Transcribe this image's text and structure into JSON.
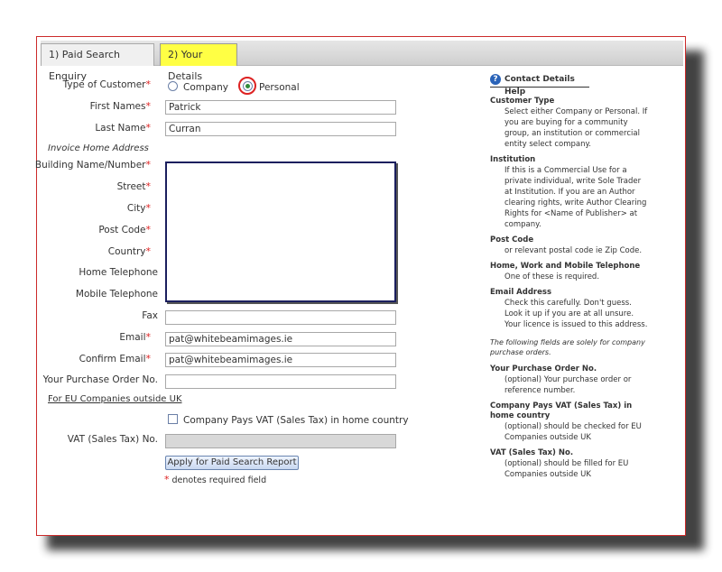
{
  "tabs": [
    {
      "label": "1) Paid Search Enquiry"
    },
    {
      "label": "2) Your Details"
    }
  ],
  "form": {
    "customer_type_label": "Type of Customer",
    "customer_type_options": [
      "Company",
      "Personal"
    ],
    "customer_type_selected": "Personal",
    "first_names_label": "First Names",
    "first_names_value": "Patrick",
    "last_name_label": "Last Name",
    "last_name_value": "Curran",
    "invoice_section": "Invoice Home Address",
    "building_label": "Building Name/Number",
    "street_label": "Street",
    "city_label": "City",
    "postcode_label": "Post Code",
    "country_label": "Country",
    "home_tel_label": "Home Telephone",
    "mobile_tel_label": "Mobile Telephone",
    "fax_label": "Fax",
    "fax_value": "",
    "email_label": "Email",
    "email_value": "pat@whitebeamimages.ie",
    "confirm_email_label": "Confirm Email",
    "confirm_email_value": "pat@whitebeamimages.ie",
    "po_label": "Your Purchase Order No.",
    "po_value": "",
    "eu_link": "For EU Companies outside UK",
    "vat_checkbox_label": "Company Pays VAT (Sales Tax) in home country",
    "vat_checked": false,
    "vat_label": "VAT (Sales Tax) No.",
    "vat_value": "",
    "submit_label": "Apply for Paid Search Report",
    "required_star": "*",
    "required_note": "denotes required field"
  },
  "help": {
    "title": "Contact Details Help",
    "icon": "question-icon",
    "items": [
      {
        "title": "Customer Type",
        "text": "Select either Company or Personal. If you are buying for a community group, an institution or commercial entity select company."
      },
      {
        "title": "Institution",
        "text": "If this is a Commercial Use for a private individual, write Sole Trader at Institution. If you are an Author clearing rights, write Author Clearing Rights for <Name of Publisher> at company."
      },
      {
        "title": "Post Code",
        "text": "or relevant postal code ie Zip Code."
      },
      {
        "title": "Home, Work and Mobile Telephone",
        "text": "One of these is required."
      },
      {
        "title": "Email Address",
        "text": "Check this carefully. Don't guess. Look it up if you are at all unsure. Your licence is issued to this address."
      }
    ],
    "note": "The following fields are solely for company purchase orders.",
    "items2": [
      {
        "title": "Your Purchase Order No.",
        "text": "(optional) Your purchase order or reference number."
      },
      {
        "title": "Company Pays VAT (Sales Tax) in home country",
        "text": "(optional) should be checked for EU Companies outside UK"
      },
      {
        "title": "VAT (Sales Tax) No.",
        "text": "(optional) should be filled for EU Companies outside UK"
      }
    ]
  },
  "colors": {
    "frame_border": "#cc2a2a",
    "active_tab": "#ffff44",
    "required": "#dd2222",
    "overlay_border": "#1b1f5e"
  }
}
